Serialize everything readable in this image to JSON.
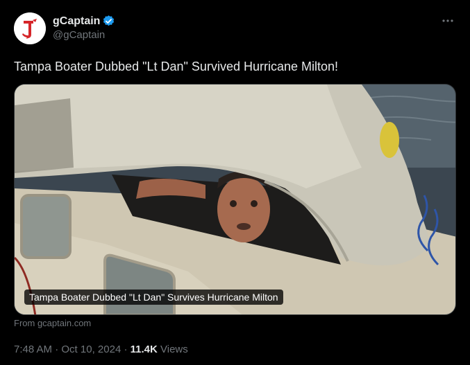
{
  "author": {
    "name": "gCaptain",
    "handle": "@gCaptain",
    "verified": true,
    "avatar_icon": "gcaptain-logo",
    "verified_color": "#1d9bf0"
  },
  "tweet": {
    "text": "Tampa Boater Dubbed \"Lt Dan\" Survived Hurricane Milton!"
  },
  "media": {
    "caption": "Tampa Boater Dubbed \"Lt Dan\" Survives Hurricane Milton",
    "source": "From gcaptain.com"
  },
  "meta": {
    "time": "7:48 AM",
    "sep1": " · ",
    "date": "Oct 10, 2024",
    "sep2": " · ",
    "views_count": "11.4K",
    "views_label": " Views"
  },
  "menu": {
    "more_icon": "more-horizontal-icon"
  },
  "colors": {
    "background": "#000000",
    "text": "#e7e9ea",
    "secondary": "#71767b",
    "border": "#2f3336",
    "logo_red": "#d6262a"
  }
}
